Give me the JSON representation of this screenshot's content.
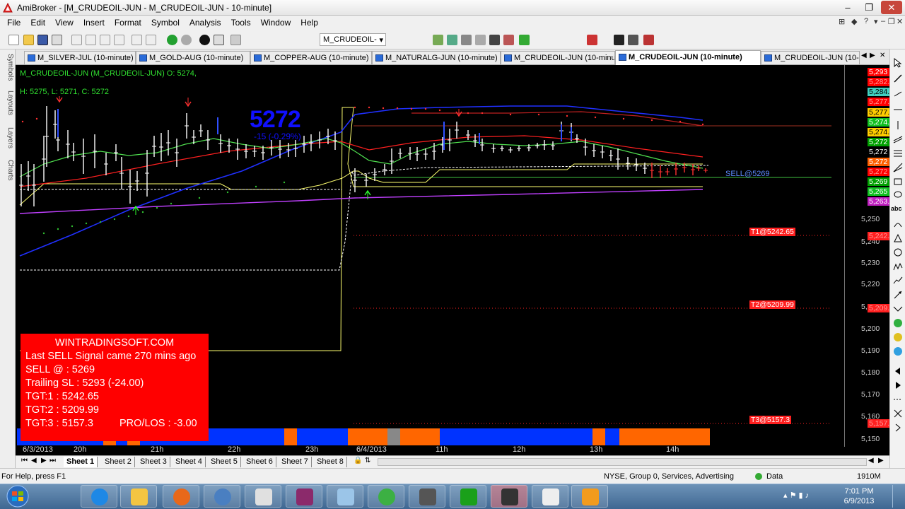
{
  "window": {
    "title": "AmiBroker - [M_CRUDEOIL-JUN - M_CRUDEOIL-JUN - 10-minute]",
    "controls": [
      "–",
      "❐",
      "✕"
    ],
    "inner_controls": [
      "–",
      "❐",
      "✕"
    ]
  },
  "menu": {
    "items": [
      "File",
      "Edit",
      "View",
      "Insert",
      "Format",
      "Symbol",
      "Analysis",
      "Tools",
      "Window",
      "Help"
    ],
    "right_glyphs": [
      "⊞",
      "◆",
      "?",
      "▾"
    ]
  },
  "toolbar": {
    "symbol_value": "M_CRUDEOIL-",
    "symbol_arrow": "▾"
  },
  "left_tabs": [
    "Symbols",
    "Layouts",
    "Layers",
    "Charts"
  ],
  "doc_tabs": [
    {
      "label": "M_SILVER-JUL (10-minute)",
      "active": false
    },
    {
      "label": "M_GOLD-AUG (10-minute)",
      "active": false
    },
    {
      "label": "M_COPPER-AUG (10-minute)",
      "active": false
    },
    {
      "label": "M_NATURALG-JUN (10-minute)",
      "active": false
    },
    {
      "label": "M_CRUDEOIL-JUN (10-minute)",
      "active": false
    },
    {
      "label": "M_CRUDEOIL-JUN (10-minute)",
      "active": true
    },
    {
      "label": "M_CRUDEOIL-JUN (10-m",
      "active": false
    }
  ],
  "doc_tab_scroll": [
    "◀",
    "▶",
    "✕"
  ],
  "chart": {
    "header_line1": "M_CRUDEOIL-JUN (M_CRUDEOIL-JUN) O: 5274,",
    "header_line2": "H: 5275, L: 5271, C: 5272",
    "big_price": "5272",
    "big_change": "-15 (-0.29%)",
    "signal_label": "SELL@5269",
    "targets": [
      {
        "label": "T1@5242.65",
        "price_tag": "5,242.65"
      },
      {
        "label": "T2@5209.99",
        "price_tag": "5,209.99"
      },
      {
        "label": "T3@5157.3",
        "price_tag": "5,157.3"
      }
    ],
    "axis_ticks": [
      "5,250",
      "5,240",
      "5,230",
      "5,220",
      "5,210",
      "5,200",
      "5,190",
      "5,180",
      "5,170",
      "5,160",
      "5,150",
      "5,270"
    ],
    "price_tags": [
      {
        "text": "5,293",
        "bg": "#ff0000",
        "fg": "#ffffff"
      },
      {
        "text": "5,282.72",
        "bg": "#ff0000",
        "fg": "#ff9a9a"
      },
      {
        "text": "5,284.14",
        "bg": "#40d0c0",
        "fg": "#000000"
      },
      {
        "text": "5,277.8",
        "bg": "#ff0000",
        "fg": "#ff9a9a"
      },
      {
        "text": "5,277.3",
        "bg": "#ffcc00",
        "fg": "#000000"
      },
      {
        "text": "5,274.78",
        "bg": "#10c020",
        "fg": "#ffffff"
      },
      {
        "text": "5,274.57",
        "bg": "#ffcc00",
        "fg": "#000000"
      },
      {
        "text": "5,272",
        "bg": "#00a000",
        "fg": "#ffffff"
      },
      {
        "text": "5,272",
        "bg": "#000000",
        "fg": "#ffffff"
      },
      {
        "text": "5,272",
        "bg": "#ff6000",
        "fg": "#ffffff"
      },
      {
        "text": "5,272",
        "bg": "#ff0000",
        "fg": "#ff9a9a"
      },
      {
        "text": "5,269",
        "bg": "#00a000",
        "fg": "#ffffff"
      },
      {
        "text": "5,265",
        "bg": "#10c020",
        "fg": "#ffffff"
      },
      {
        "text": "5,263.6",
        "bg": "#c020c0",
        "fg": "#ffffff"
      }
    ],
    "time_labels": [
      "6/3/2013",
      "20h",
      "21h",
      "22h",
      "23h",
      "6/4/2013",
      "11h",
      "12h",
      "13h",
      "14h"
    ]
  },
  "infobox": {
    "site": "WINTRADINGSOFT.COM",
    "signal_line": "Last SELL Signal came 270 mins ago",
    "sell": "SELL @ : 5269",
    "trailing": "Trailing SL : 5293 (-24.00)",
    "tgt1": "TGT:1 : 5242.65",
    "tgt2": "TGT:2 : 5209.99",
    "tgt3": "TGT:3 : 5157.3",
    "prolos": "PRO/LOS : -3.00"
  },
  "sheets": {
    "nav": [
      "⏮",
      "◀",
      "▶",
      "⏭"
    ],
    "tabs": [
      "Sheet 1",
      "Sheet 2",
      "Sheet 3",
      "Sheet 4",
      "Sheet 5",
      "Sheet 6",
      "Sheet 7",
      "Sheet 8"
    ],
    "extra": [
      "🔒",
      "⇅"
    ],
    "scroll_arrows": [
      "◀",
      "▶"
    ]
  },
  "status": {
    "help": "For Help, press F1",
    "exchange": "NYSE, Group 0, Services, Advertising",
    "data": "Data",
    "memory": "1910M"
  },
  "taskbar": {
    "time": "7:01 PM",
    "date": "6/9/2013"
  }
}
